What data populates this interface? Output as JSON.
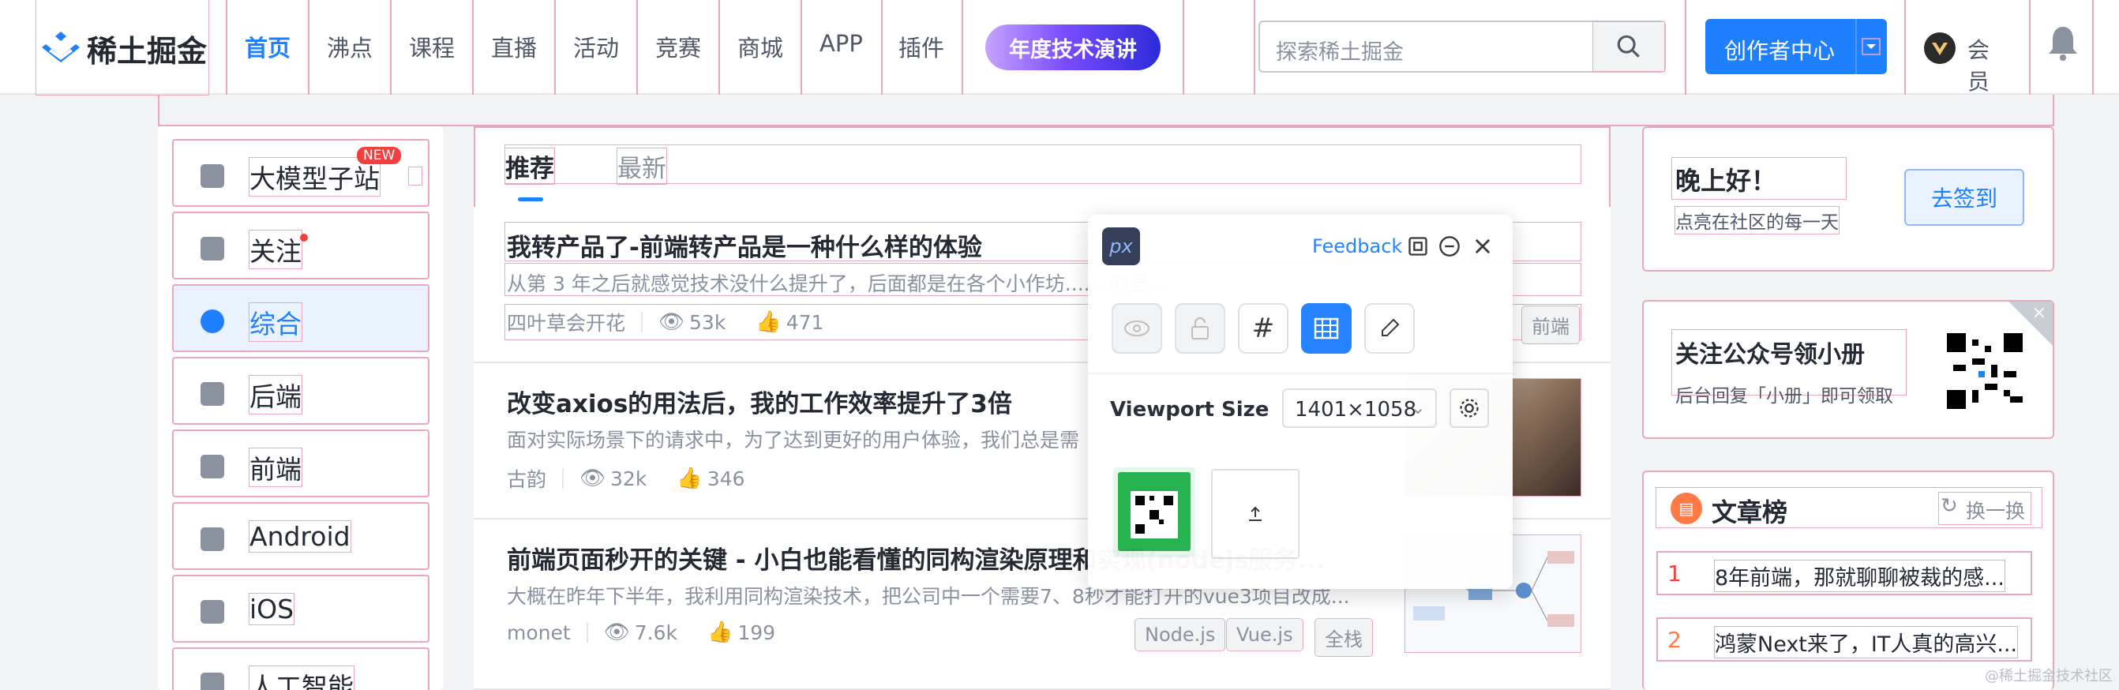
{
  "header": {
    "logo_text": "稀土掘金",
    "nav": [
      "首页",
      "沸点",
      "课程",
      "直播",
      "活动",
      "竞赛",
      "商城",
      "APP",
      "插件"
    ],
    "promo": "年度技术演讲",
    "search_placeholder": "探索稀土掘金",
    "creator_btn": "创作者中心",
    "member": "会员"
  },
  "sidebar": {
    "items": [
      {
        "label": "大模型子站",
        "badge": "NEW"
      },
      {
        "label": "关注"
      },
      {
        "label": "综合"
      },
      {
        "label": "后端"
      },
      {
        "label": "前端"
      },
      {
        "label": "Android"
      },
      {
        "label": "iOS"
      },
      {
        "label": "人工智能"
      }
    ]
  },
  "feed": {
    "tabs": [
      "推荐",
      "最新"
    ],
    "articles": [
      {
        "title": "我转产品了-前端转产品是一种什么样的体验",
        "brief": "从第 3 年之后就感觉技术没什么提升了，后面都是在各个小作坊...... 哪里...",
        "author": "四叶草会开花",
        "views": "53k",
        "likes": "471",
        "tags": [
          "前端"
        ]
      },
      {
        "title": "改变axios的用法后，我的工作效率提升了3倍",
        "brief": "面对实际场景下的请求中，为了达到更好的用户体验，我们总是需",
        "author": "古韵",
        "views": "32k",
        "likes": "346",
        "tags": []
      },
      {
        "title": "前端页面秒开的关键 - 小白也能看懂的同构渲染原理和实现(nodejs服务...",
        "brief": "大概在昨年下半年，我利用同构渲染技术，把公司中一个需要7、8秒才能打开的vue3项目改成...",
        "author": "monet",
        "views": "7.6k",
        "likes": "199",
        "tags": [
          "Node.js",
          "Vue.js",
          "全栈"
        ]
      }
    ]
  },
  "right": {
    "greeting": "晚上好！",
    "greeting_sub": "点亮在社区的每一天",
    "signin": "去签到",
    "wechat_title": "关注公众号领小册",
    "wechat_sub": "后台回复「小册」即可领取",
    "rank_title": "文章榜",
    "rank_refresh": "换一换",
    "rank": [
      {
        "no": "1",
        "title": "8年前端，那就聊聊被裁的感..."
      },
      {
        "no": "2",
        "title": "鸿蒙Next来了，IT人真的高兴..."
      }
    ]
  },
  "overlay": {
    "logo": "px",
    "feedback": "Feedback",
    "viewport_label": "Viewport Size",
    "viewport_value": "1401×1058"
  },
  "watermark": "@稀土掘金技术社区"
}
